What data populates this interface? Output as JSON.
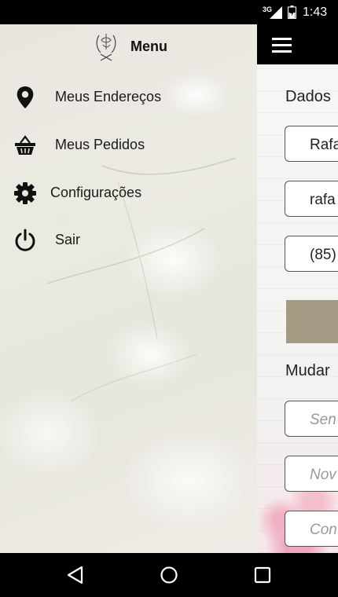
{
  "status_bar": {
    "network": "3G",
    "time": "1:43"
  },
  "drawer": {
    "title": "Menu",
    "logo_icon": "crest-logo",
    "items": [
      {
        "label": "Meus Endereços",
        "icon": "location-pin-icon"
      },
      {
        "label": "Meus Pedidos",
        "icon": "shopping-basket-icon"
      },
      {
        "label": "Configurações",
        "icon": "gear-icon"
      },
      {
        "label": "Sair",
        "icon": "power-icon"
      }
    ]
  },
  "background_screen": {
    "menu_icon": "hamburger-icon",
    "section1_title": "Dados",
    "name_value": "Rafa",
    "email_value": "rafa",
    "phone_value": "(85)",
    "section2_title": "Mudar",
    "password_placeholder": "Sen",
    "new_password_placeholder": "Nov",
    "confirm_password_placeholder": "Con",
    "button_color": "#a29a82"
  },
  "nav_bar": {
    "back": "back-triangle-icon",
    "home": "home-circle-icon",
    "recents": "recents-square-icon"
  }
}
